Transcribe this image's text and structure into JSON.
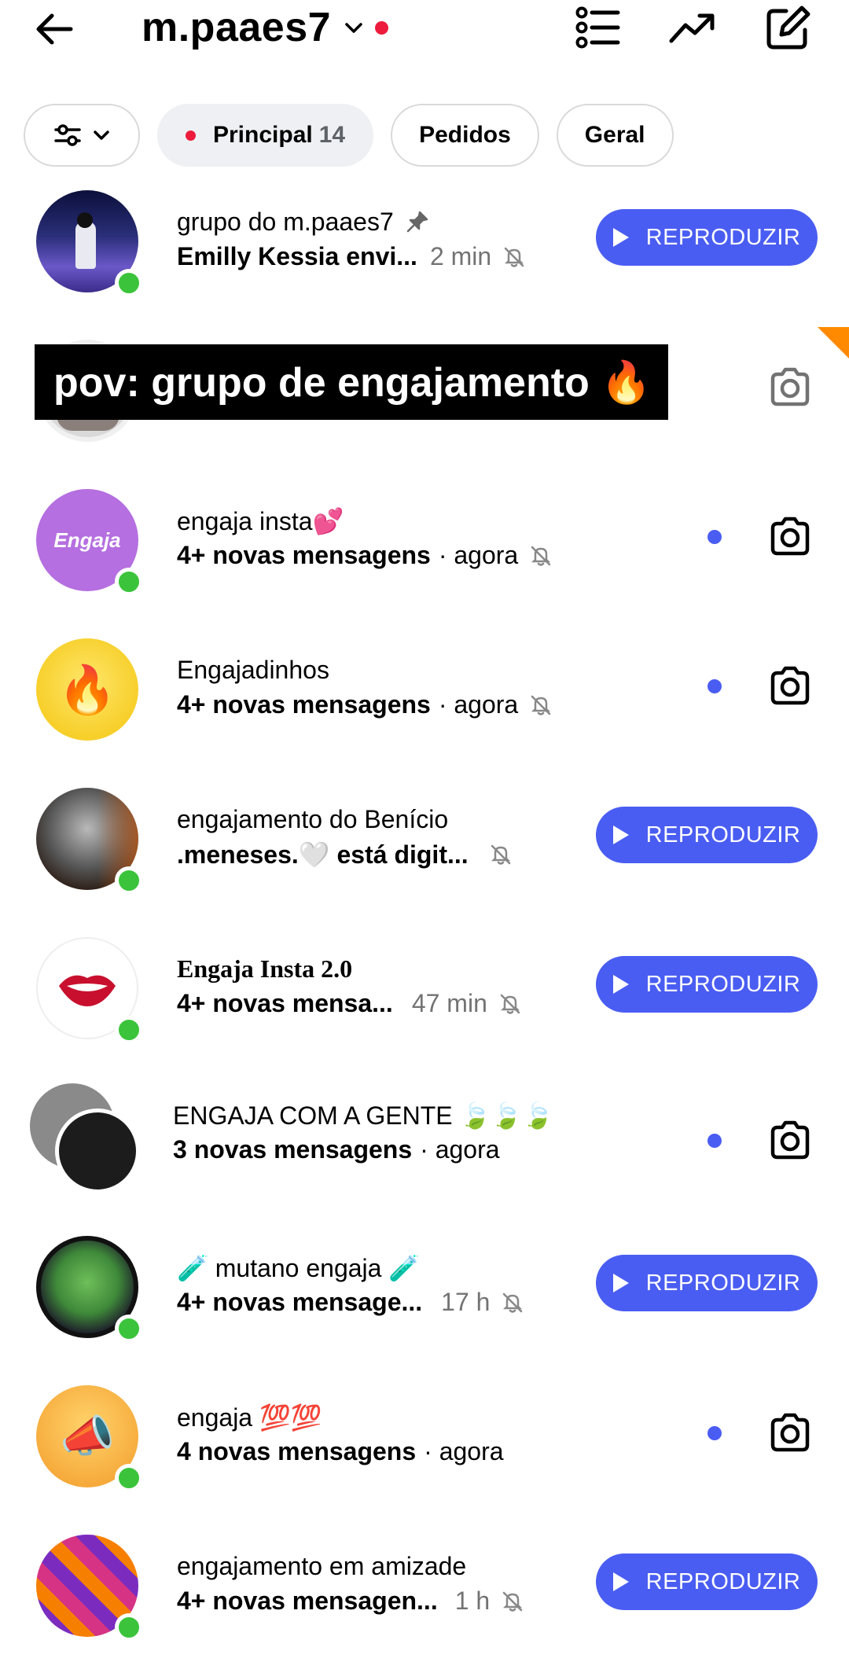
{
  "header": {
    "username": "m.paaes7",
    "icons": [
      "back-arrow-icon",
      "chevron-down-icon",
      "list-icon",
      "trending-icon",
      "compose-icon"
    ]
  },
  "chips": {
    "principal_label": "Principal",
    "principal_count": "14",
    "pedidos_label": "Pedidos",
    "geral_label": "Geral"
  },
  "overlay": {
    "caption": "pov: grupo de engajamento 🔥"
  },
  "actions": {
    "play_label": "REPRODUZIR"
  },
  "threads": [
    {
      "name": "grupo do m.paaes7",
      "pinned": true,
      "preview": "Emilly Kessia envi...",
      "time": "2 min"
    },
    {
      "name": "",
      "preview": "",
      "time": ""
    },
    {
      "name": "engaja insta💕",
      "preview": "4+ novas mensagens",
      "time": "· agora",
      "avatar_text": "Engaja"
    },
    {
      "name": "Engajadinhos",
      "preview": "4+ novas mensagens",
      "time": "· agora"
    },
    {
      "name": "engajamento do Benício",
      "preview": ".meneses.🤍 está digit...",
      "time": ""
    },
    {
      "name": "Engaja Insta 2.0",
      "preview": "4+ novas mensa...",
      "time": "47 min"
    },
    {
      "name": "ENGAJA COM A GENTE 🍃🍃🍃",
      "preview": "3 novas mensagens",
      "time": "· agora"
    },
    {
      "name": "🧪 mutano engaja 🧪",
      "preview": "4+ novas mensage...",
      "time": "17 h"
    },
    {
      "name": "engaja 💯💯",
      "preview": "4 novas mensagens",
      "time": "· agora"
    },
    {
      "name": "engajamento em amizade",
      "preview": "4+ novas mensagen...",
      "time": "1 h"
    }
  ],
  "colors": {
    "accent": "#4a5df2",
    "notify_red": "#ed1c3c",
    "online_green": "#3bc43b"
  }
}
